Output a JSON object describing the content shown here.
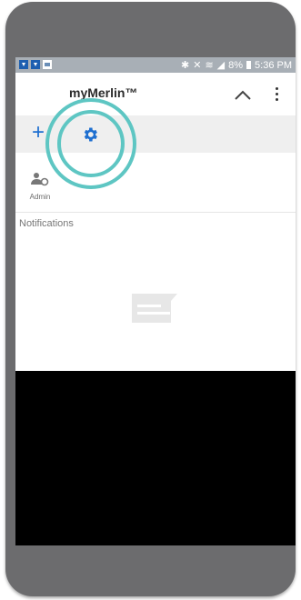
{
  "statusbar": {
    "left_icons": [
      "download-icon",
      "download-icon",
      "image-icon"
    ],
    "battery": "8%",
    "time": "5:36 PM"
  },
  "appbar": {
    "title": "myMerlin™"
  },
  "toolbar": {
    "plus": "+"
  },
  "user": {
    "label": "Admin"
  },
  "section": {
    "notifications": "Notifications"
  },
  "colors": {
    "accent": "#1e6fd0",
    "ring": "#5ec6c3",
    "statusbar": "#a8afb6",
    "phone": "#6c6c6e"
  }
}
